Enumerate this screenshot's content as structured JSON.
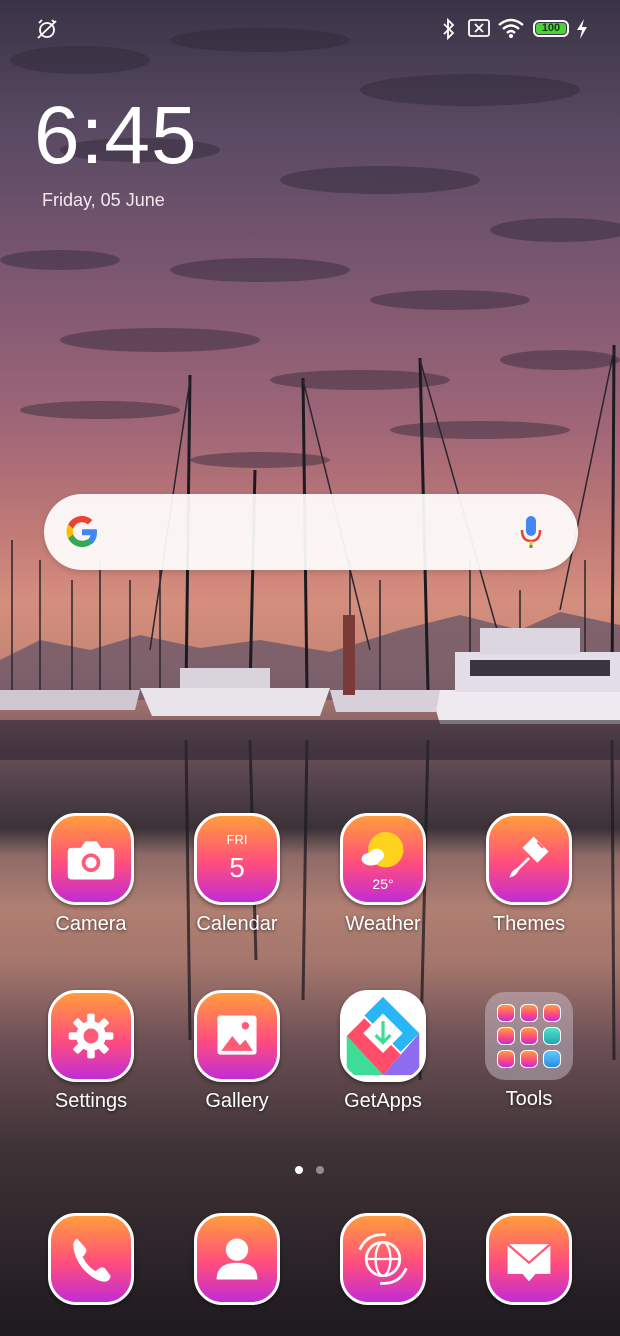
{
  "status_bar": {
    "icons": [
      "alarm-off-icon",
      "bluetooth-icon",
      "sim-none-icon",
      "wifi-icon",
      "battery-icon",
      "charging-icon"
    ],
    "battery_level": "100"
  },
  "clock": {
    "time": "6:45",
    "date": "Friday, 05 June"
  },
  "search": {
    "logo": "google-logo",
    "mic": "mic-icon"
  },
  "apps_row1": [
    {
      "label": "Camera",
      "icon": "camera-icon"
    },
    {
      "label": "Calendar",
      "icon": "calendar-icon",
      "day": "FRI",
      "date": "5"
    },
    {
      "label": "Weather",
      "icon": "weather-icon",
      "temp": "25°"
    },
    {
      "label": "Themes",
      "icon": "brush-icon"
    }
  ],
  "apps_row2": [
    {
      "label": "Settings",
      "icon": "gear-icon"
    },
    {
      "label": "Gallery",
      "icon": "image-icon"
    },
    {
      "label": "GetApps",
      "icon": "getapps-icon"
    },
    {
      "label": "Tools",
      "icon": "folder-icon"
    }
  ],
  "page_indicator": {
    "pages": 2,
    "current": 1
  },
  "dock": [
    {
      "icon": "phone-icon"
    },
    {
      "icon": "contacts-icon"
    },
    {
      "icon": "browser-icon"
    },
    {
      "icon": "messages-icon"
    }
  ],
  "colors": {
    "accent_top": "#ff9d3c",
    "accent_mid": "#ff4d7e",
    "accent_bottom": "#c22cd6",
    "battery": "#4cd137"
  }
}
